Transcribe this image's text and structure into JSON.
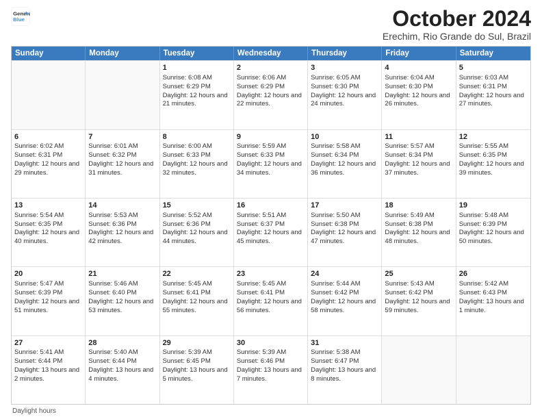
{
  "header": {
    "logo_line1": "General",
    "logo_line2": "Blue",
    "month_title": "October 2024",
    "location": "Erechim, Rio Grande do Sul, Brazil"
  },
  "calendar": {
    "days_of_week": [
      "Sunday",
      "Monday",
      "Tuesday",
      "Wednesday",
      "Thursday",
      "Friday",
      "Saturday"
    ],
    "rows": [
      [
        {
          "day": "",
          "empty": true,
          "sunrise": "",
          "sunset": "",
          "daylight": ""
        },
        {
          "day": "",
          "empty": true,
          "sunrise": "",
          "sunset": "",
          "daylight": ""
        },
        {
          "day": "1",
          "empty": false,
          "sunrise": "Sunrise: 6:08 AM",
          "sunset": "Sunset: 6:29 PM",
          "daylight": "Daylight: 12 hours and 21 minutes."
        },
        {
          "day": "2",
          "empty": false,
          "sunrise": "Sunrise: 6:06 AM",
          "sunset": "Sunset: 6:29 PM",
          "daylight": "Daylight: 12 hours and 22 minutes."
        },
        {
          "day": "3",
          "empty": false,
          "sunrise": "Sunrise: 6:05 AM",
          "sunset": "Sunset: 6:30 PM",
          "daylight": "Daylight: 12 hours and 24 minutes."
        },
        {
          "day": "4",
          "empty": false,
          "sunrise": "Sunrise: 6:04 AM",
          "sunset": "Sunset: 6:30 PM",
          "daylight": "Daylight: 12 hours and 26 minutes."
        },
        {
          "day": "5",
          "empty": false,
          "sunrise": "Sunrise: 6:03 AM",
          "sunset": "Sunset: 6:31 PM",
          "daylight": "Daylight: 12 hours and 27 minutes."
        }
      ],
      [
        {
          "day": "6",
          "empty": false,
          "sunrise": "Sunrise: 6:02 AM",
          "sunset": "Sunset: 6:31 PM",
          "daylight": "Daylight: 12 hours and 29 minutes."
        },
        {
          "day": "7",
          "empty": false,
          "sunrise": "Sunrise: 6:01 AM",
          "sunset": "Sunset: 6:32 PM",
          "daylight": "Daylight: 12 hours and 31 minutes."
        },
        {
          "day": "8",
          "empty": false,
          "sunrise": "Sunrise: 6:00 AM",
          "sunset": "Sunset: 6:33 PM",
          "daylight": "Daylight: 12 hours and 32 minutes."
        },
        {
          "day": "9",
          "empty": false,
          "sunrise": "Sunrise: 5:59 AM",
          "sunset": "Sunset: 6:33 PM",
          "daylight": "Daylight: 12 hours and 34 minutes."
        },
        {
          "day": "10",
          "empty": false,
          "sunrise": "Sunrise: 5:58 AM",
          "sunset": "Sunset: 6:34 PM",
          "daylight": "Daylight: 12 hours and 36 minutes."
        },
        {
          "day": "11",
          "empty": false,
          "sunrise": "Sunrise: 5:57 AM",
          "sunset": "Sunset: 6:34 PM",
          "daylight": "Daylight: 12 hours and 37 minutes."
        },
        {
          "day": "12",
          "empty": false,
          "sunrise": "Sunrise: 5:55 AM",
          "sunset": "Sunset: 6:35 PM",
          "daylight": "Daylight: 12 hours and 39 minutes."
        }
      ],
      [
        {
          "day": "13",
          "empty": false,
          "sunrise": "Sunrise: 5:54 AM",
          "sunset": "Sunset: 6:35 PM",
          "daylight": "Daylight: 12 hours and 40 minutes."
        },
        {
          "day": "14",
          "empty": false,
          "sunrise": "Sunrise: 5:53 AM",
          "sunset": "Sunset: 6:36 PM",
          "daylight": "Daylight: 12 hours and 42 minutes."
        },
        {
          "day": "15",
          "empty": false,
          "sunrise": "Sunrise: 5:52 AM",
          "sunset": "Sunset: 6:36 PM",
          "daylight": "Daylight: 12 hours and 44 minutes."
        },
        {
          "day": "16",
          "empty": false,
          "sunrise": "Sunrise: 5:51 AM",
          "sunset": "Sunset: 6:37 PM",
          "daylight": "Daylight: 12 hours and 45 minutes."
        },
        {
          "day": "17",
          "empty": false,
          "sunrise": "Sunrise: 5:50 AM",
          "sunset": "Sunset: 6:38 PM",
          "daylight": "Daylight: 12 hours and 47 minutes."
        },
        {
          "day": "18",
          "empty": false,
          "sunrise": "Sunrise: 5:49 AM",
          "sunset": "Sunset: 6:38 PM",
          "daylight": "Daylight: 12 hours and 48 minutes."
        },
        {
          "day": "19",
          "empty": false,
          "sunrise": "Sunrise: 5:48 AM",
          "sunset": "Sunset: 6:39 PM",
          "daylight": "Daylight: 12 hours and 50 minutes."
        }
      ],
      [
        {
          "day": "20",
          "empty": false,
          "sunrise": "Sunrise: 5:47 AM",
          "sunset": "Sunset: 6:39 PM",
          "daylight": "Daylight: 12 hours and 51 minutes."
        },
        {
          "day": "21",
          "empty": false,
          "sunrise": "Sunrise: 5:46 AM",
          "sunset": "Sunset: 6:40 PM",
          "daylight": "Daylight: 12 hours and 53 minutes."
        },
        {
          "day": "22",
          "empty": false,
          "sunrise": "Sunrise: 5:45 AM",
          "sunset": "Sunset: 6:41 PM",
          "daylight": "Daylight: 12 hours and 55 minutes."
        },
        {
          "day": "23",
          "empty": false,
          "sunrise": "Sunrise: 5:45 AM",
          "sunset": "Sunset: 6:41 PM",
          "daylight": "Daylight: 12 hours and 56 minutes."
        },
        {
          "day": "24",
          "empty": false,
          "sunrise": "Sunrise: 5:44 AM",
          "sunset": "Sunset: 6:42 PM",
          "daylight": "Daylight: 12 hours and 58 minutes."
        },
        {
          "day": "25",
          "empty": false,
          "sunrise": "Sunrise: 5:43 AM",
          "sunset": "Sunset: 6:42 PM",
          "daylight": "Daylight: 12 hours and 59 minutes."
        },
        {
          "day": "26",
          "empty": false,
          "sunrise": "Sunrise: 5:42 AM",
          "sunset": "Sunset: 6:43 PM",
          "daylight": "Daylight: 13 hours and 1 minute."
        }
      ],
      [
        {
          "day": "27",
          "empty": false,
          "sunrise": "Sunrise: 5:41 AM",
          "sunset": "Sunset: 6:44 PM",
          "daylight": "Daylight: 13 hours and 2 minutes."
        },
        {
          "day": "28",
          "empty": false,
          "sunrise": "Sunrise: 5:40 AM",
          "sunset": "Sunset: 6:44 PM",
          "daylight": "Daylight: 13 hours and 4 minutes."
        },
        {
          "day": "29",
          "empty": false,
          "sunrise": "Sunrise: 5:39 AM",
          "sunset": "Sunset: 6:45 PM",
          "daylight": "Daylight: 13 hours and 5 minutes."
        },
        {
          "day": "30",
          "empty": false,
          "sunrise": "Sunrise: 5:39 AM",
          "sunset": "Sunset: 6:46 PM",
          "daylight": "Daylight: 13 hours and 7 minutes."
        },
        {
          "day": "31",
          "empty": false,
          "sunrise": "Sunrise: 5:38 AM",
          "sunset": "Sunset: 6:47 PM",
          "daylight": "Daylight: 13 hours and 8 minutes."
        },
        {
          "day": "",
          "empty": true,
          "sunrise": "",
          "sunset": "",
          "daylight": ""
        },
        {
          "day": "",
          "empty": true,
          "sunrise": "",
          "sunset": "",
          "daylight": ""
        }
      ]
    ],
    "footer_note": "Daylight hours"
  }
}
